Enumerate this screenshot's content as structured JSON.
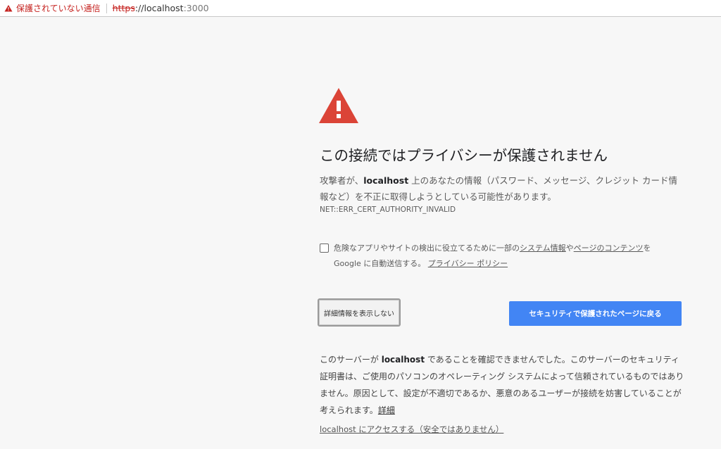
{
  "address_bar": {
    "security_label": "保護されていない通信",
    "url_scheme": "https",
    "url_separator": "://",
    "url_host": "localhost",
    "url_port": ":3000",
    "icon": "warning-icon"
  },
  "interstitial": {
    "icon": "warning-icon",
    "icon_color": "#db4437",
    "heading": "この接続ではプライバシーが保護されません",
    "message_prefix": "攻撃者が、",
    "message_host": "localhost",
    "message_suffix": " 上のあなたの情報（パスワード、メッセージ、クレジット カード情報など）を不正に取得しようとしている可能性があります。",
    "error_code": "NET::ERR_CERT_AUTHORITY_INVALID",
    "optin": {
      "checked": false,
      "text_prefix": "危険なアプリやサイトの検出に役立てるために一部の",
      "link_system_info": "システム情報",
      "text_middle": "や",
      "link_page_content": "ページのコンテンツ",
      "text_suffix": "を Google に自動送信する。",
      "link_privacy": "プライバシー ポリシー"
    },
    "details_button": "詳細情報を表示しない",
    "back_button": "セキュリティで保護されたページに戻る",
    "back_button_color": "#4285f4",
    "explanation_prefix": "このサーバーが ",
    "explanation_host": "localhost",
    "explanation_suffix": " であることを確認できませんでした。このサーバーのセキュリティ証明書は、ご使用のパソコンのオペレーティング システムによって信頼されているものではありません。原因として、設定が不適切であるか、悪意のあるユーザーが接続を妨害していることが考えられます。",
    "learn_more_link": "詳細",
    "proceed_link": "localhost にアクセスする（安全ではありません）"
  }
}
